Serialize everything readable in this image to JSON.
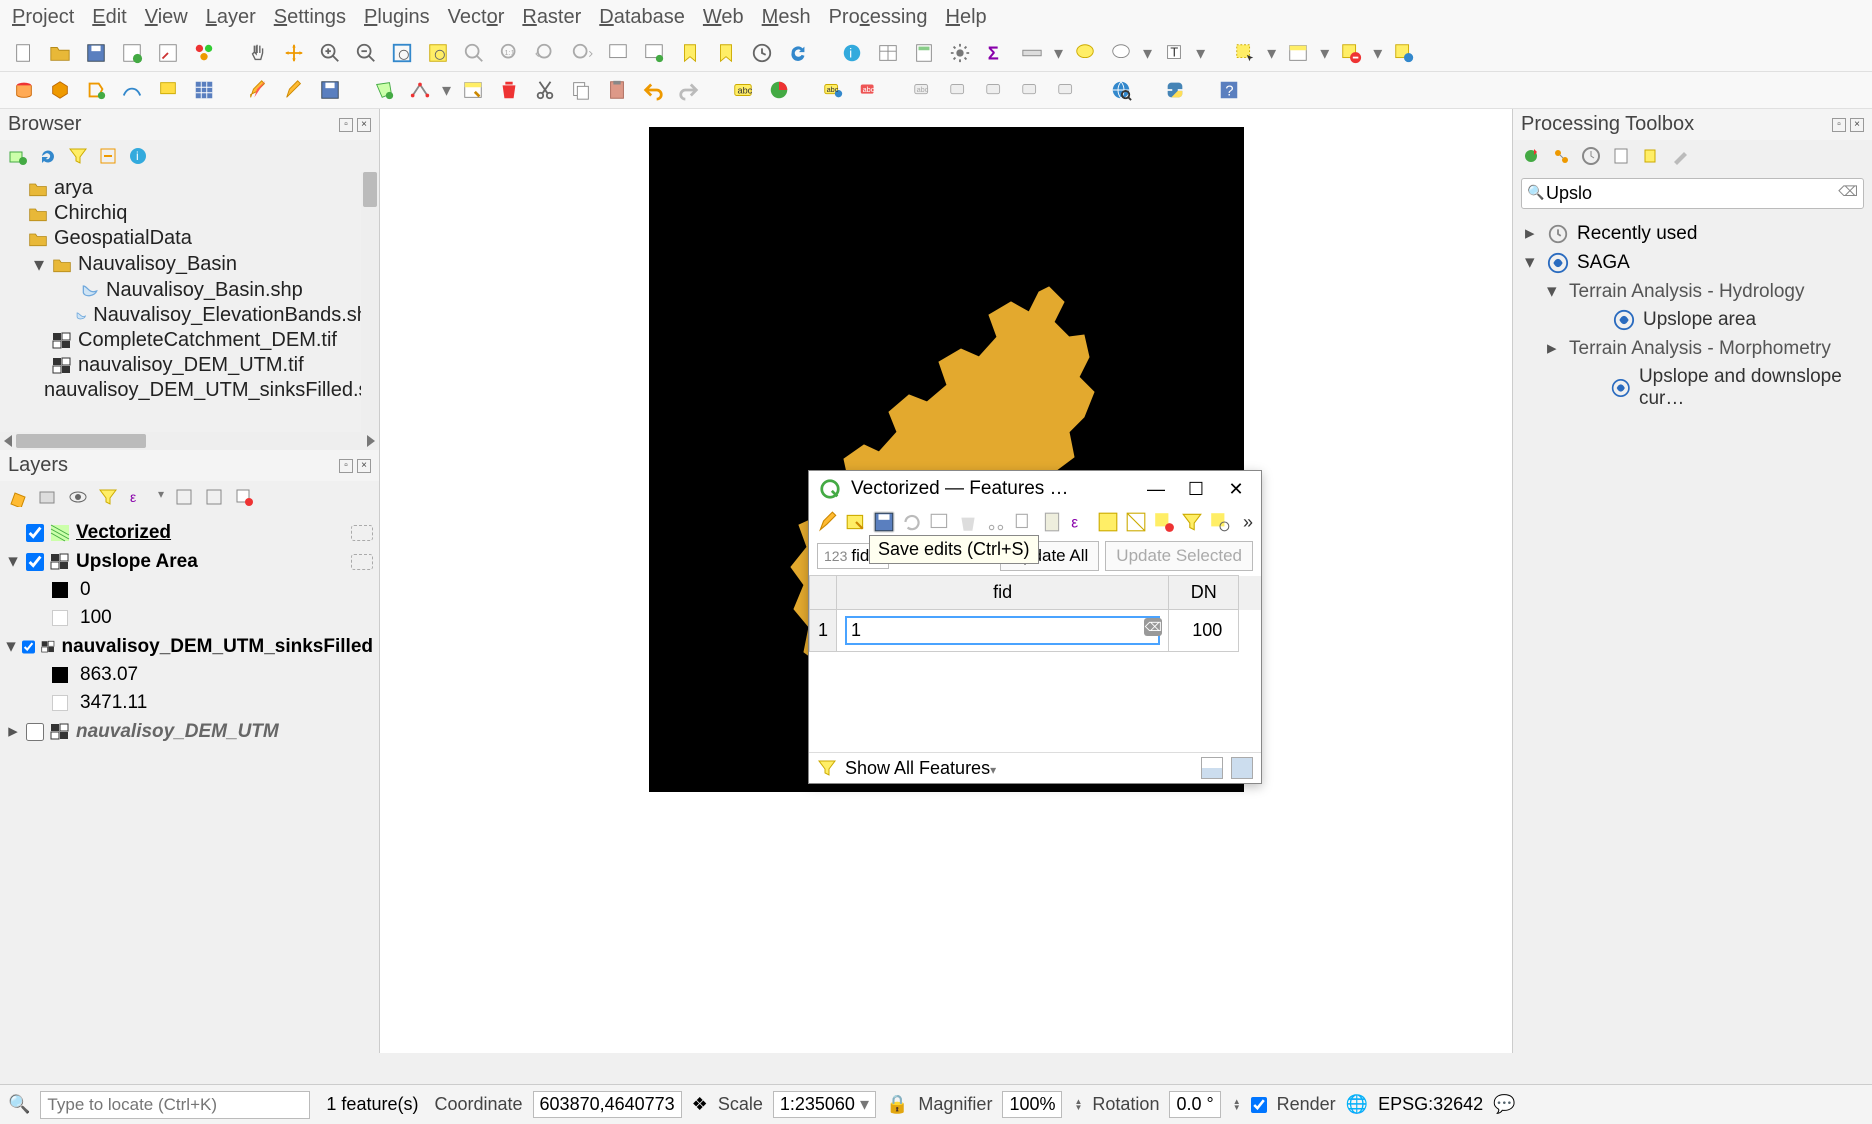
{
  "menus": [
    "Project",
    "Edit",
    "View",
    "Layer",
    "Settings",
    "Plugins",
    "Vector",
    "Raster",
    "Database",
    "Web",
    "Mesh",
    "Processing",
    "Help"
  ],
  "browser": {
    "title": "Browser",
    "items": [
      {
        "level": 1,
        "icon": "folder",
        "label": "arya"
      },
      {
        "level": 1,
        "icon": "folder",
        "label": "Chirchiq"
      },
      {
        "level": 1,
        "icon": "folder",
        "label": "GeospatialData",
        "expander": ""
      },
      {
        "level": 2,
        "icon": "folder",
        "label": "Nauvalisoy_Basin",
        "expander": "▾"
      },
      {
        "level": 3,
        "icon": "vectpoly",
        "label": "Nauvalisoy_Basin.shp"
      },
      {
        "level": 3,
        "icon": "vectpoly",
        "label": "Nauvalisoy_ElevationBands.shp"
      },
      {
        "level": 2,
        "icon": "raster",
        "label": "CompleteCatchment_DEM.tif"
      },
      {
        "level": 2,
        "icon": "raster",
        "label": "nauvalisoy_DEM_UTM.tif"
      },
      {
        "level": 2,
        "icon": "raster",
        "label": "nauvalisoy_DEM_UTM_sinksFilled.sdat"
      }
    ]
  },
  "layers": {
    "title": "Layers",
    "items": [
      {
        "type": "group",
        "checked": true,
        "icon": "hatch",
        "label": "Vectorized",
        "style": "boldu",
        "chip": true
      },
      {
        "type": "group",
        "checked": true,
        "icon": "rasterbw",
        "label": "Upslope Area",
        "style": "bold",
        "chip": true,
        "expander": "▾",
        "children": [
          {
            "swatch": "#000000",
            "label": "0"
          },
          {
            "swatch": "",
            "label": "100"
          }
        ]
      },
      {
        "type": "group",
        "checked": true,
        "icon": "rasterbw",
        "label": "nauvalisoy_DEM_UTM_sinksFilled",
        "style": "bold",
        "expander": "▾",
        "children": [
          {
            "swatch": "#000000",
            "label": "863.07"
          },
          {
            "swatch": "",
            "label": "3471.11"
          }
        ]
      },
      {
        "type": "group",
        "checked": false,
        "icon": "rasterbw",
        "label": "nauvalisoy_DEM_UTM",
        "style": "italic",
        "expander": "▸"
      }
    ]
  },
  "processing": {
    "title": "Processing Toolbox",
    "search": "Upslo",
    "tree": [
      {
        "lvl": 1,
        "exp": "▸",
        "icon": "clock",
        "label": "Recently used"
      },
      {
        "lvl": 1,
        "exp": "▾",
        "icon": "saga",
        "label": "SAGA"
      },
      {
        "lvl": 2,
        "exp": "▾",
        "label": "Terrain Analysis - Hydrology"
      },
      {
        "lvl": 3,
        "icon": "saga",
        "label": "Upslope area"
      },
      {
        "lvl": 2,
        "exp": "▸",
        "label": "Terrain Analysis - Morphometry"
      },
      {
        "lvl": 3,
        "icon": "saga",
        "label": "Upslope and downslope cur…"
      }
    ]
  },
  "attribute_dialog": {
    "title": "Vectorized — Features …",
    "tooltip": "Save edits (Ctrl+S)",
    "fid_label": "fid",
    "fid_prefix": "123",
    "update_all": "Update All",
    "update_selected": "Update Selected",
    "columns": [
      "fid",
      "DN"
    ],
    "row_index": "1",
    "fid_value": "1",
    "dn_value": "100",
    "footer_label": "Show All Features"
  },
  "statusbar": {
    "locator_placeholder": "Type to locate (Ctrl+K)",
    "feature_count": "1 feature(s)",
    "coord_label": "Coordinate",
    "coord_value": "603870,4640773",
    "scale_label": "Scale",
    "scale_value": "1:235060",
    "magnifier_label": "Magnifier",
    "magnifier_value": "100%",
    "rotation_label": "Rotation",
    "rotation_value": "0.0 °",
    "render_label": "Render",
    "crs": "EPSG:32642"
  },
  "colors": {
    "basin": "#e3a92e"
  }
}
